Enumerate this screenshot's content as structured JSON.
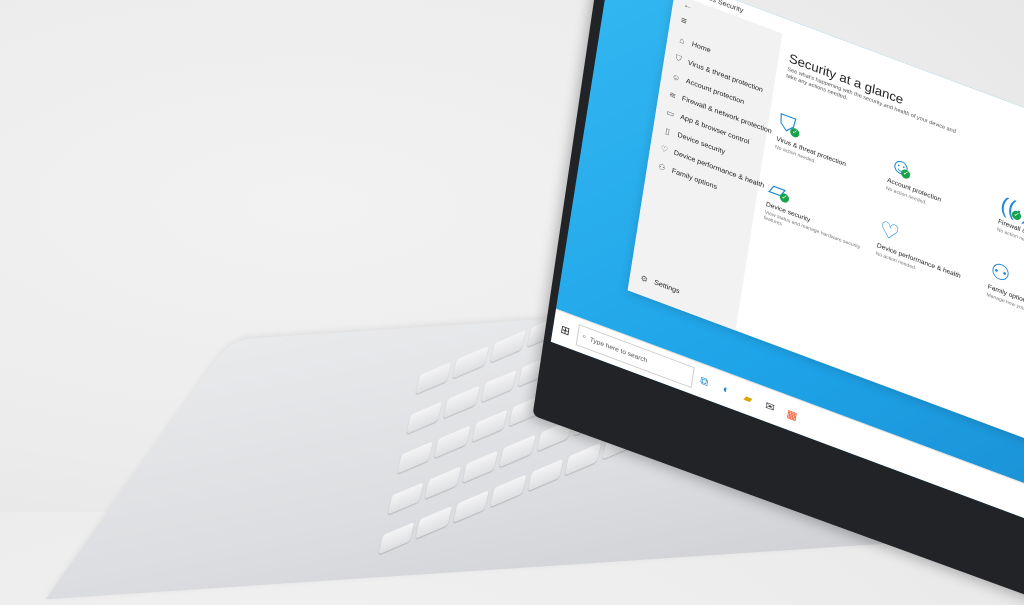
{
  "window": {
    "title": "Windows Security"
  },
  "sidebar": {
    "menu_icon": "hamburger-icon",
    "back_icon": "back-arrow-icon",
    "items": [
      {
        "label": "Home",
        "icon": "home-icon"
      },
      {
        "label": "Virus & threat protection",
        "icon": "shield-icon"
      },
      {
        "label": "Account protection",
        "icon": "person-icon"
      },
      {
        "label": "Firewall & network protection",
        "icon": "wifi-icon"
      },
      {
        "label": "App & browser control",
        "icon": "app-window-icon"
      },
      {
        "label": "Device security",
        "icon": "laptop-icon"
      },
      {
        "label": "Device performance & health",
        "icon": "heart-icon"
      },
      {
        "label": "Family options",
        "icon": "family-icon"
      }
    ],
    "settings_label": "Settings"
  },
  "main": {
    "title": "Security at a glance",
    "subtitle": "See what's happening with the security and health of your device and take any actions needed.",
    "tiles": [
      {
        "label": "Virus & threat protection",
        "status": "No action needed.",
        "icon": "shield-icon"
      },
      {
        "label": "Account protection",
        "status": "No action needed.",
        "icon": "person-icon"
      },
      {
        "label": "Firewall & network protection",
        "status": "No action needed.",
        "icon": "wifi-icon"
      },
      {
        "label": "Device security",
        "status": "View status and manage hardware security features",
        "icon": "laptop-icon"
      },
      {
        "label": "Device performance & health",
        "status": "No action needed.",
        "icon": "heart-icon"
      },
      {
        "label": "Family options",
        "status": "Manage how your family uses their devices.",
        "icon": "family-icon"
      }
    ]
  },
  "taskbar": {
    "search_placeholder": "Type here to search",
    "icons": [
      "start-icon",
      "search-icon",
      "task-view-icon",
      "edge-icon",
      "file-explorer-icon",
      "mail-icon",
      "store-icon"
    ]
  },
  "colors": {
    "accent": "#1E88D6",
    "wallpaper": "#1EA3E8",
    "ok": "#16A34A"
  }
}
